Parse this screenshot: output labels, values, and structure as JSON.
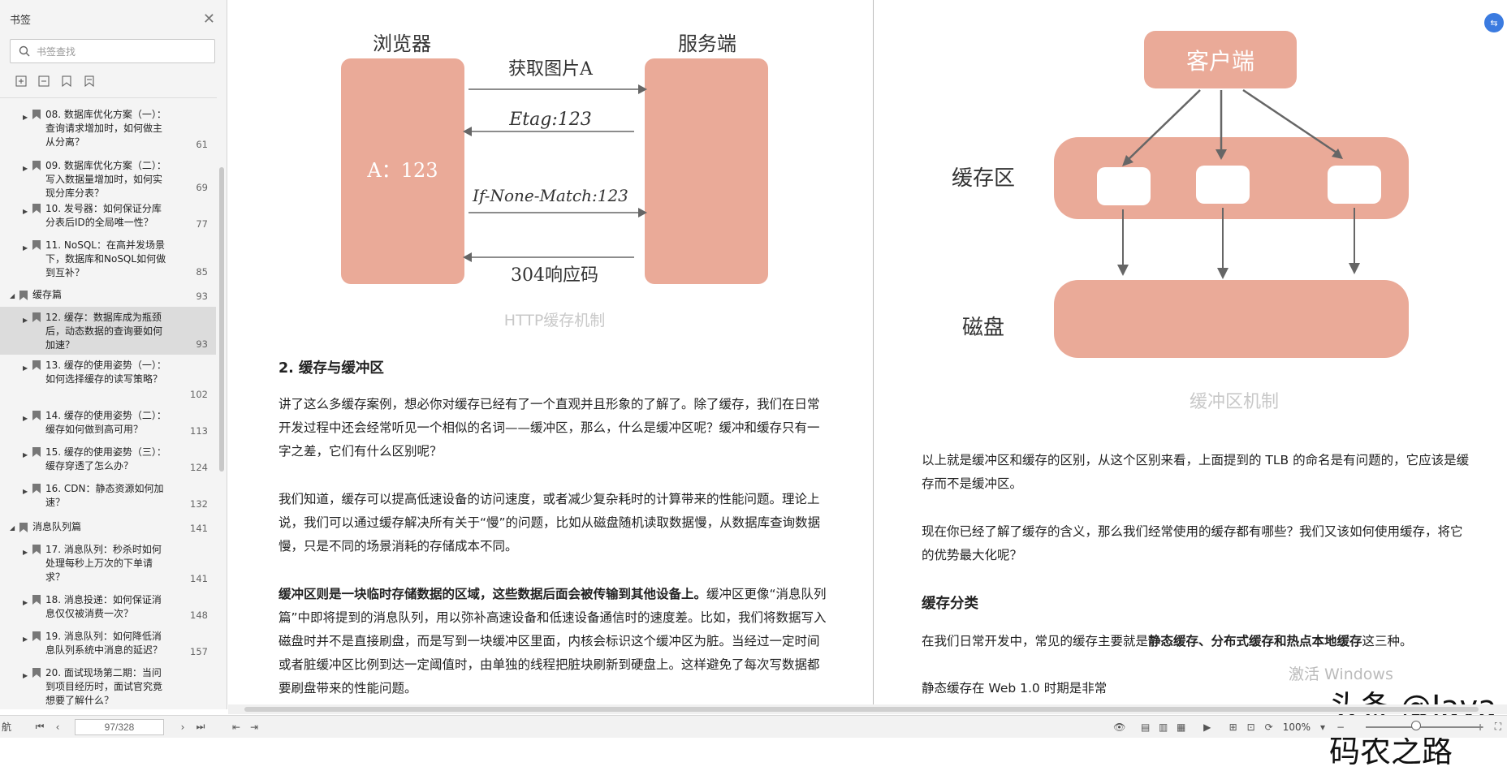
{
  "sidebar": {
    "title": "书签",
    "search_placeholder": "书签查找",
    "items": [
      {
        "label": "08. 数据库优化方案（一）：查询请求增加时，如何做主从分离？",
        "page": "61"
      },
      {
        "label": "09. 数据库优化方案（二）：写入数据量增加时，如何实现分库分表？",
        "page": "69"
      },
      {
        "label": "10. 发号器：如何保证分库分表后ID的全局唯一性？",
        "page": "77"
      },
      {
        "label": "11. NoSQL：在高并发场景下，数据库和NoSQL如何做到互补？",
        "page": "85"
      },
      {
        "label": "缓存篇",
        "page": "93"
      },
      {
        "label": "12. 缓存：数据库成为瓶颈后，动态数据的查询要如何加速？",
        "page": "93"
      },
      {
        "label": "13. 缓存的使用姿势（一）：如何选择缓存的读写策略？",
        "page": "102"
      },
      {
        "label": "14. 缓存的使用姿势（二）：缓存如何做到高可用？",
        "page": "113"
      },
      {
        "label": "15. 缓存的使用姿势（三）：缓存穿透了怎么办？",
        "page": "124"
      },
      {
        "label": "16. CDN：静态资源如何加速？",
        "page": "132"
      },
      {
        "label": "消息队列篇",
        "page": "141"
      },
      {
        "label": "17. 消息队列：秒杀时如何处理每秒上万次的下单请求？",
        "page": "141"
      },
      {
        "label": "18. 消息投递：如何保证消息仅仅被消费一次？",
        "page": "148"
      },
      {
        "label": "19. 消息队列：如何降低消息队列系统中消息的延迟？",
        "page": "157"
      },
      {
        "label": "20. 面试现场第二期：当问到项目经历时，面试官究竟想要了解什么？",
        "page": ""
      }
    ]
  },
  "diagram_http": {
    "browser": "浏览器",
    "server": "服务端",
    "a_value": "A：123",
    "msg1": "获取图片A",
    "msg2": "Etag:123",
    "msg3": "If-None-Match:123",
    "msg4": "304响应码",
    "caption": "HTTP缓存机制"
  },
  "diagram_buffer": {
    "client": "客户端",
    "cache_area": "缓存区",
    "disk": "磁盘",
    "caption": "缓冲区机制"
  },
  "left_page": {
    "heading": "2. 缓存与缓冲区",
    "para1": "讲了这么多缓存案例，想必你对缓存已经有了一个直观并且形象的了解了。除了缓存，我们在日常开发过程中还会经常听见一个相似的名词——缓冲区，那么，什么是缓冲区呢？缓冲和缓存只有一字之差，它们有什么区别呢？",
    "para2": "我们知道，缓存可以提高低速设备的访问速度，或者减少复杂耗时的计算带来的性能问题。理论上说，我们可以通过缓存解决所有关于“慢”的问题，比如从磁盘随机读取数据慢，从数据库查询数据慢，只是不同的场景消耗的存储成本不同。",
    "para3_bold": "缓冲区则是一块临时存储数据的区域，这些数据后面会被传输到其他设备上。",
    "para3_rest": "缓冲区更像“消息队列篇”中即将提到的消息队列，用以弥补高速设备和低速设备通信时的速度差。比如，我们将数据写入磁盘时并不是直接刷盘，而是写到一块缓冲区里面，内核会标识这个缓冲区为脏。当经过一定时间或者脏缓冲区比例到达一定阈值时，由单独的线程把脏块刷新到硬盘上。这样避免了每次写数据都要刷盘带来的性能问题。"
  },
  "right_page": {
    "para1": "以上就是缓冲区和缓存的区别，从这个区别来看，上面提到的 TLB 的命名是有问题的，它应该是缓存而不是缓冲区。",
    "para2": "现在你已经了解了缓存的含义，那么我们经常使用的缓存都有哪些？我们又该如何使用缓存，将它的优势最大化呢？",
    "heading": "缓存分类",
    "para3_pre": "在我们日常开发中，常见的缓存主要就是",
    "para3_bold": "静态缓存、分布式缓存和热点本地缓存",
    "para3_post": "这三种。",
    "para4": "静态缓存在 Web 1.0 时期是非常"
  },
  "watermark": {
    "windows": "激活 Windows",
    "brand": "头条 @Java码农之路"
  },
  "statusbar": {
    "nav_label": "航",
    "page_value": "97/328",
    "zoom": "100%"
  },
  "colors": {
    "salmon": "#eaaa98",
    "arrow": "#666666"
  }
}
